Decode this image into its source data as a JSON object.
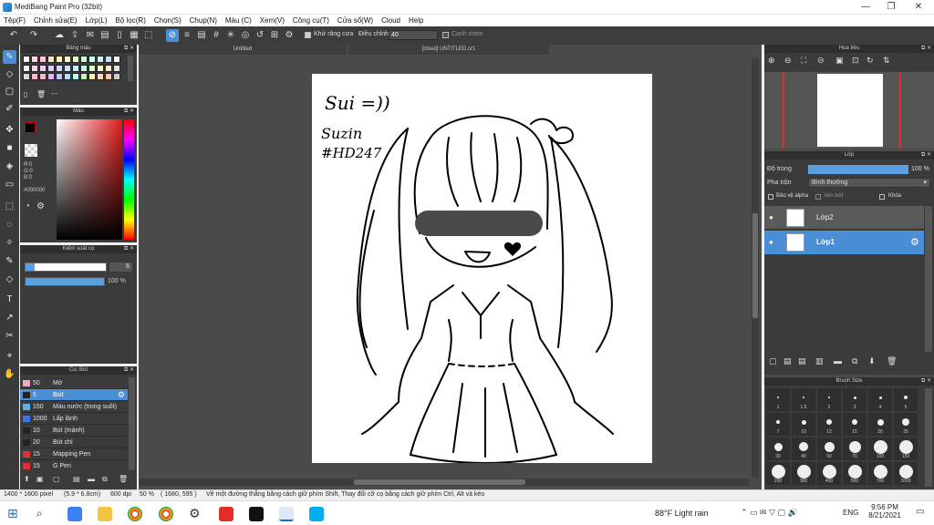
{
  "window": {
    "title": "MediBang Paint Pro (32bit)",
    "minimize": "—",
    "maximize": "❐",
    "close": "✕"
  },
  "menu": [
    "Tệp(F)",
    "Chỉnh sửa(E)",
    "Lớp(L)",
    "Bộ lọc(R)",
    "Chọn(S)",
    "Chụp(N)",
    "Màu (C)",
    "Xem(V)",
    "Công cụ(T)",
    "Cửa sổ(W)",
    "Cloud",
    "Help"
  ],
  "toolbar": {
    "antialias_label": "Khử răng cưa",
    "adjust_label": "Điều chỉnh",
    "adjust_value": "40",
    "smooth_label": "Canh mém"
  },
  "colors": {
    "accent": "#4a8ed6",
    "panel": "#3b3b3b",
    "canvas_bg": "#4b4b4b",
    "primary_color": "#000000"
  },
  "palette_panel": {
    "title": "Bảng màu",
    "swatches": [
      "#ffffff",
      "#ffd6e8",
      "#ffc7ce",
      "#ffe0c2",
      "#fff2b3",
      "#fffbcc",
      "#e6ffcc",
      "#ccffd9",
      "#ccfff2",
      "#ccf2ff",
      "#cce0ff",
      "#ffffff",
      "#f2f2f2",
      "#ffd1e6",
      "#f7c8ff",
      "#e0ccff",
      "#d1d6ff",
      "#c7e3ff",
      "#c2f0ff",
      "#c2ffe8",
      "#d6ffc2",
      "#f5ffc2",
      "#ffeec2",
      "#e6e6e6",
      "#d9d9d9",
      "#ffb3d1",
      "#ffb3c7",
      "#e6b3ff",
      "#b3c6ff",
      "#b3e0ff",
      "#b3ffee",
      "#c2ffb3",
      "#fff5b3",
      "#ffd9b3",
      "#ffc2b3",
      "#cccccc"
    ],
    "label": "---"
  },
  "color_panel": {
    "title": "Màu",
    "r": "R:0",
    "g": "G:0",
    "b": "B:0",
    "hex": "#000000"
  },
  "brush_control": {
    "title": "Kiểm soát cọ",
    "size": "6",
    "opacity": "100 %",
    "opacity_level": 1.0
  },
  "brush_panel": {
    "title": "Cọ: Bút",
    "items": [
      {
        "size": "50",
        "name": "Mờ",
        "color": "#f5a3c9"
      },
      {
        "size": "6",
        "name": "Bút",
        "color": "#222222",
        "selected": true
      },
      {
        "size": "150",
        "name": "Màu nước (trong suốt)",
        "color": "#4fb8e6"
      },
      {
        "size": "1000",
        "name": "Lấp lánh",
        "color": "#3a78e0"
      },
      {
        "size": "10",
        "name": "Bút (mảnh)",
        "color": "#222222"
      },
      {
        "size": "20",
        "name": "Bút chì",
        "color": "#222222"
      },
      {
        "size": "15",
        "name": "Mapping Pen",
        "color": "#e03030"
      },
      {
        "size": "15",
        "name": "G Pen",
        "color": "#e03030"
      }
    ]
  },
  "canvas": {
    "tabs": [
      "Untitled",
      "[cloud] UNTITLED.cr1"
    ],
    "text_line1": "Sui =))",
    "text_line2": "Suzin",
    "text_line3": "#HD247"
  },
  "navigator": {
    "title": "Hoa tiêu"
  },
  "layer_panel": {
    "title": "Lớp",
    "opacity_label": "Độ trong",
    "opacity_value": "100 %",
    "opacity_level": 1.0,
    "blend_label": "Pha trộn",
    "blend_value": "Bình thường",
    "protect_alpha": "Bảo vệ alpha",
    "clipping": "Xén bớt",
    "lock": "Khóa",
    "layers": [
      {
        "name": "Lớp2",
        "selected": false
      },
      {
        "name": "Lớp1",
        "selected": true
      }
    ]
  },
  "brush_size_panel": {
    "title": "Brush Size",
    "rows": [
      [
        "1",
        "1.5",
        "2",
        "3",
        "4",
        "5"
      ],
      [
        "7",
        "10",
        "12",
        "15",
        "20",
        "25"
      ],
      [
        "30",
        "40",
        "50",
        "70",
        "100",
        "150"
      ],
      [
        "200",
        "300",
        "400",
        "500",
        "700",
        "1000"
      ]
    ]
  },
  "statusbar": {
    "dimensions": "1400 * 1600 pixel",
    "physical": "(5.9 * 6.8cm)",
    "dpi": "600 dpi",
    "zoom": "50 %",
    "cursor": "( 1680, 595 )",
    "hint": "Vẽ một đường thẳng bằng cách giữ phím Shift, Thay đổi cỡ cọ bằng cách giữ phím Ctrl, Alt và kéo"
  },
  "taskbar": {
    "weather": "88°F  Light rain",
    "lang": "ENG",
    "time": "9:56 PM",
    "date": "8/21/2021"
  }
}
